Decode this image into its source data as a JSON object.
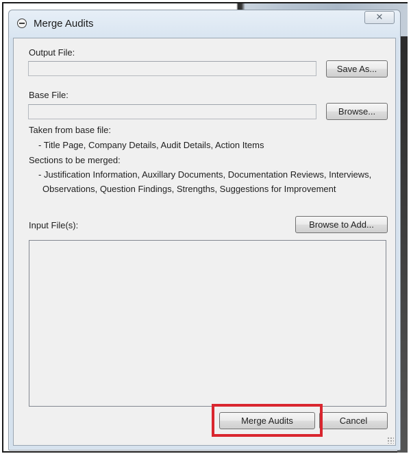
{
  "window": {
    "title": "Merge Audits",
    "close_glyph": "✕"
  },
  "output_file": {
    "label": "Output File:",
    "value": "",
    "button_label": "Save As..."
  },
  "base_file": {
    "label": "Base File:",
    "value": "",
    "button_label": "Browse..."
  },
  "info": {
    "taken_heading": "Taken from base file:",
    "taken_items": "- Title Page, Company Details, Audit Details, Action Items",
    "merged_heading": "Sections to be merged:",
    "merged_items_line1": "- Justification Information, Auxillary Documents, Documentation Reviews, Interviews,",
    "merged_items_line2": "Observations, Question Findings, Strengths, Suggestions for Improvement"
  },
  "input_files": {
    "label": "Input File(s):",
    "button_label": "Browse to Add...",
    "items": []
  },
  "footer": {
    "merge_label": "Merge Audits",
    "cancel_label": "Cancel"
  },
  "colors": {
    "highlight": "#d9262f",
    "window_frame": "#d6e2ee",
    "client_bg": "#f0f0f0"
  }
}
